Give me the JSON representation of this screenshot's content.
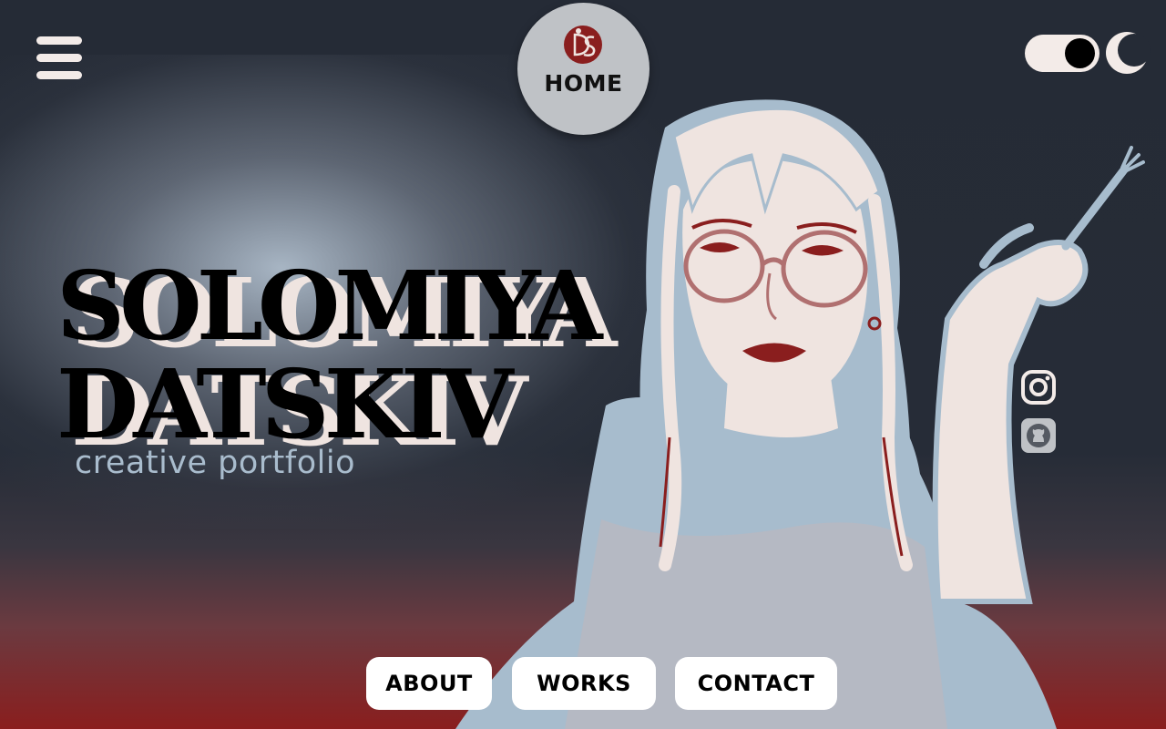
{
  "header": {
    "menu_icon": "hamburger-menu-icon",
    "home_label": "HOME",
    "logo_icon": "ds-monogram-logo",
    "theme_toggle_icon": "toggle-switch-icon",
    "theme_moon_icon": "crescent-moon-icon"
  },
  "hero": {
    "name_line_1": "SOLOMIYA",
    "name_line_2": "DATSKIV",
    "subtitle": "creative portfolio"
  },
  "social": {
    "instagram_icon": "instagram-icon",
    "github_icon": "github-icon"
  },
  "nav": {
    "about": "ABOUT",
    "works": "WORKS",
    "contact": "CONTACT"
  },
  "colors": {
    "background": "#262c37",
    "accent_red": "#8a1e1e",
    "cream": "#efe4e0",
    "steel_blue": "#a9bccd"
  }
}
